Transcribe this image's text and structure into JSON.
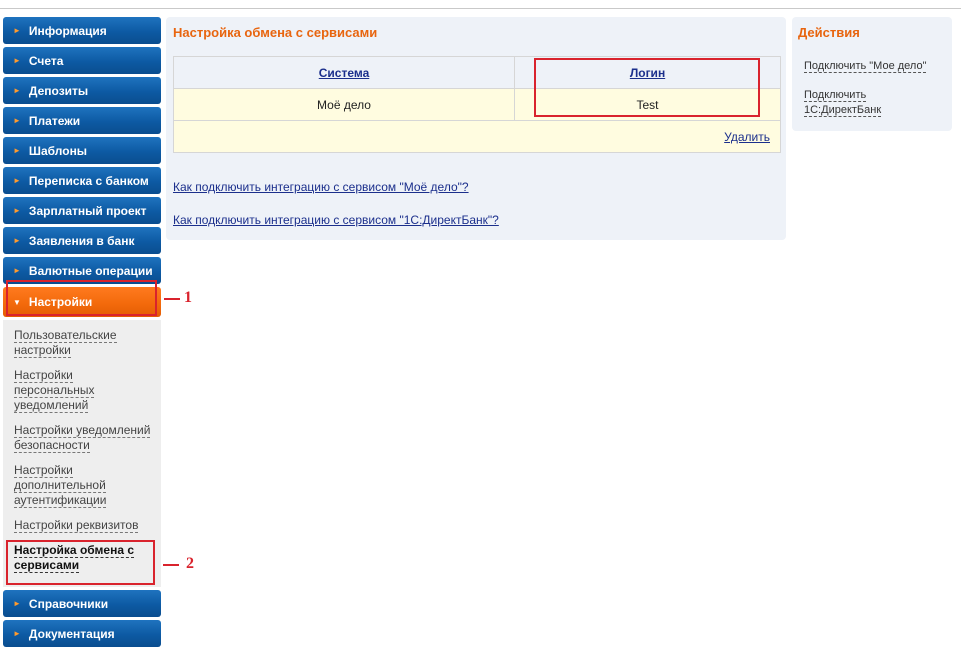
{
  "top_fragment": "",
  "sidebar": {
    "items_top": [
      {
        "label": "Информация"
      },
      {
        "label": "Счета"
      },
      {
        "label": "Депозиты"
      },
      {
        "label": "Платежи"
      },
      {
        "label": "Шаблоны"
      },
      {
        "label": "Переписка с банком"
      },
      {
        "label": "Зарплатный проект"
      },
      {
        "label": "Заявления в банк"
      },
      {
        "label": "Валютные операции"
      }
    ],
    "active": {
      "label": "Настройки"
    },
    "submenu": [
      {
        "label": "Пользовательские настройки"
      },
      {
        "label": "Настройки персональных уведомлений"
      },
      {
        "label": "Настройки уведомлений безопасности"
      },
      {
        "label": "Настройки дополнительной аутентификации"
      },
      {
        "label": "Настройки реквизитов"
      },
      {
        "label": "Настройка обмена с сервисами"
      }
    ],
    "items_bottom": [
      {
        "label": "Справочники"
      },
      {
        "label": "Документация"
      }
    ]
  },
  "main": {
    "title": "Настройка обмена с сервисами",
    "table": {
      "headers": [
        "Система",
        "Логин"
      ],
      "rows": [
        [
          "Моё дело",
          "Test"
        ]
      ],
      "delete_label": "Удалить"
    },
    "help_links": [
      "Как подключить интеграцию с сервисом \"Моё дело\"?",
      "Как подключить интеграцию с сервисом \"1С:ДиректБанк\"?"
    ]
  },
  "actions": {
    "title": "Действия",
    "links": [
      "Подключить \"Мое дело\"",
      "Подключить 1С:ДиректБанк"
    ]
  },
  "callouts": [
    "1",
    "2"
  ],
  "colors": {
    "nav_blue": "#0d5aa3",
    "nav_active_orange": "#f36a0c",
    "heading_orange": "#e8650f",
    "link_blue": "#1b2f8c",
    "callout_red": "#d9232d",
    "row_highlight": "#fffce0",
    "panel_bg": "#eef2f8"
  }
}
